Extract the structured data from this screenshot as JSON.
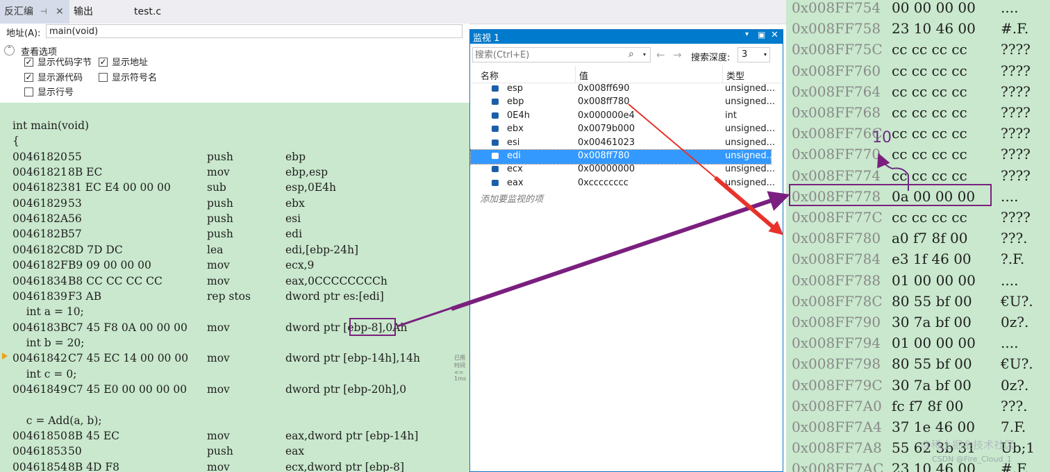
{
  "tabs": [
    {
      "label": "反汇编",
      "pin": "⊣",
      "close": "✕"
    },
    {
      "label": "输出"
    },
    {
      "label": "test.c"
    }
  ],
  "address": {
    "label": "地址(A):",
    "value": "main(void)"
  },
  "view_options": {
    "title": "查看选项",
    "collapse_icon": "⌃",
    "checkboxes": [
      {
        "label": "显示代码字节",
        "checked": true
      },
      {
        "label": "显示地址",
        "checked": true
      },
      {
        "label": "显示源代码",
        "checked": true
      },
      {
        "label": "显示符号名",
        "checked": false
      },
      {
        "label": "显示行号",
        "checked": false
      }
    ]
  },
  "code": {
    "lines": [
      {
        "src": "int main(void)"
      },
      {
        "src": "{"
      },
      {
        "addr": "00461820",
        "bytes": "55",
        "mn": "push",
        "op": "ebp"
      },
      {
        "addr": "00461821",
        "bytes": "8B EC",
        "mn": "mov",
        "op": "ebp,esp"
      },
      {
        "addr": "00461823",
        "bytes": "81 EC E4 00 00 00",
        "mn": "sub",
        "op": "esp,0E4h"
      },
      {
        "addr": "00461829",
        "bytes": "53",
        "mn": "push",
        "op": "ebx"
      },
      {
        "addr": "0046182A",
        "bytes": "56",
        "mn": "push",
        "op": "esi"
      },
      {
        "addr": "0046182B",
        "bytes": "57",
        "mn": "push",
        "op": "edi"
      },
      {
        "addr": "0046182C",
        "bytes": "8D 7D DC",
        "mn": "lea",
        "op": "edi,[ebp-24h]"
      },
      {
        "addr": "0046182F",
        "bytes": "B9 09 00 00 00",
        "mn": "mov",
        "op": "ecx,9"
      },
      {
        "addr": "00461834",
        "bytes": "B8 CC CC CC CC",
        "mn": "mov",
        "op": "eax,0CCCCCCCCh"
      },
      {
        "addr": "00461839",
        "bytes": "F3 AB",
        "mn": "rep stos",
        "op": "dword ptr es:[edi]"
      },
      {
        "src": "    int a = 10;"
      },
      {
        "addr": "0046183B",
        "bytes": "C7 45 F8 0A 00 00 00",
        "mn": "mov",
        "op": "dword ptr [ebp-8],0Ah"
      },
      {
        "src": "    int b = 20;"
      },
      {
        "addr": "00461842",
        "bytes": "C7 45 EC 14 00 00 00",
        "mn": "mov",
        "op": "dword ptr [ebp-14h],14h"
      },
      {
        "src": "    int c = 0;"
      },
      {
        "addr": "00461849",
        "bytes": "C7 45 E0 00 00 00 00",
        "mn": "mov",
        "op": "dword ptr [ebp-20h],0"
      },
      {
        "src": ""
      },
      {
        "src": "    c = Add(a, b);"
      },
      {
        "addr": "00461850",
        "bytes": "8B 45 EC",
        "mn": "mov",
        "op": "eax,dword ptr [ebp-14h]"
      },
      {
        "addr": "00461853",
        "bytes": "50",
        "mn": "push",
        "op": "eax"
      },
      {
        "addr": "00461854",
        "bytes": "8B 4D F8",
        "mn": "mov",
        "op": "ecx,dword ptr [ebp-8]"
      }
    ],
    "hint": "已用时间 <= 1ms"
  },
  "watch": {
    "title": "监视 1",
    "caret": "▾",
    "maximize": "▣",
    "close": "✕",
    "search_placeholder": "搜索(Ctrl+E)",
    "search_icon": "⌕",
    "dropdown": "▾",
    "back": "←",
    "forward": "→",
    "depth_label": "搜索深度:",
    "depth_value": "3",
    "columns": [
      "名称",
      "值",
      "类型"
    ],
    "rows": [
      {
        "name": "esp",
        "value": "0x008ff690",
        "type": "unsigned..."
      },
      {
        "name": "ebp",
        "value": "0x008ff780",
        "type": "unsigned..."
      },
      {
        "name": "0E4h",
        "value": "0x000000e4",
        "type": "int"
      },
      {
        "name": "ebx",
        "value": "0x0079b000",
        "type": "unsigned..."
      },
      {
        "name": "esi",
        "value": "0x00461023",
        "type": "unsigned..."
      },
      {
        "name": "edi",
        "value": "0x008ff780",
        "type": "unsigned...",
        "selected": true
      },
      {
        "name": "ecx",
        "value": "0x00000000",
        "type": "unsigned..."
      },
      {
        "name": "eax",
        "value": "0xcccccccc",
        "type": "unsigned..."
      }
    ],
    "add_placeholder": "添加要监视的项"
  },
  "memory": {
    "rows": [
      {
        "addr": "0x008FF754",
        "bytes": "00 00 00 00",
        "chars": "...."
      },
      {
        "addr": "0x008FF758",
        "bytes": "23 10 46 00",
        "chars": "#.F."
      },
      {
        "addr": "0x008FF75C",
        "bytes": "cc cc cc cc",
        "chars": "????"
      },
      {
        "addr": "0x008FF760",
        "bytes": "cc cc cc cc",
        "chars": "????"
      },
      {
        "addr": "0x008FF764",
        "bytes": "cc cc cc cc",
        "chars": "????"
      },
      {
        "addr": "0x008FF768",
        "bytes": "cc cc cc cc",
        "chars": "????"
      },
      {
        "addr": "0x008FF76C",
        "bytes": "cc cc cc cc",
        "chars": "????"
      },
      {
        "addr": "0x008FF770",
        "bytes": "cc cc cc cc",
        "chars": "????"
      },
      {
        "addr": "0x008FF774",
        "bytes": "cc cc cc cc",
        "chars": "????"
      },
      {
        "addr": "0x008FF778",
        "bytes": "0a 00 00 00",
        "chars": "...."
      },
      {
        "addr": "0x008FF77C",
        "bytes": "cc cc cc cc",
        "chars": "????"
      },
      {
        "addr": "0x008FF780",
        "bytes": "a0 f7 8f 00",
        "chars": "???."
      },
      {
        "addr": "0x008FF784",
        "bytes": "e3 1f 46 00",
        "chars": "?.F."
      },
      {
        "addr": "0x008FF788",
        "bytes": "01 00 00 00",
        "chars": "...."
      },
      {
        "addr": "0x008FF78C",
        "bytes": "80 55 bf 00",
        "chars": "€U?."
      },
      {
        "addr": "0x008FF790",
        "bytes": "30 7a bf 00",
        "chars": "0z?."
      },
      {
        "addr": "0x008FF794",
        "bytes": "01 00 00 00",
        "chars": "...."
      },
      {
        "addr": "0x008FF798",
        "bytes": "80 55 bf 00",
        "chars": "€U?."
      },
      {
        "addr": "0x008FF79C",
        "bytes": "30 7a bf 00",
        "chars": "0z?."
      },
      {
        "addr": "0x008FF7A0",
        "bytes": "fc f7 8f 00",
        "chars": "???."
      },
      {
        "addr": "0x008FF7A4",
        "bytes": "37 1e 46 00",
        "chars": "7.F."
      },
      {
        "addr": "0x008FF7A8",
        "bytes": "55 62 3b 31",
        "chars": "Ub;1"
      },
      {
        "addr": "0x008FF7AC",
        "bytes": "23 10 46 00",
        "chars": "#.F."
      }
    ],
    "annotation": "10",
    "watermark": "CSDN @Fire_Cloud_1",
    "watermark2": "@稀土掘金技术社区"
  },
  "colors": {
    "annotation_purple": "#7a1f7f",
    "arrow_red": "#e8322a",
    "code_bg": "#c9e8cd",
    "selection": "#3399ff"
  }
}
